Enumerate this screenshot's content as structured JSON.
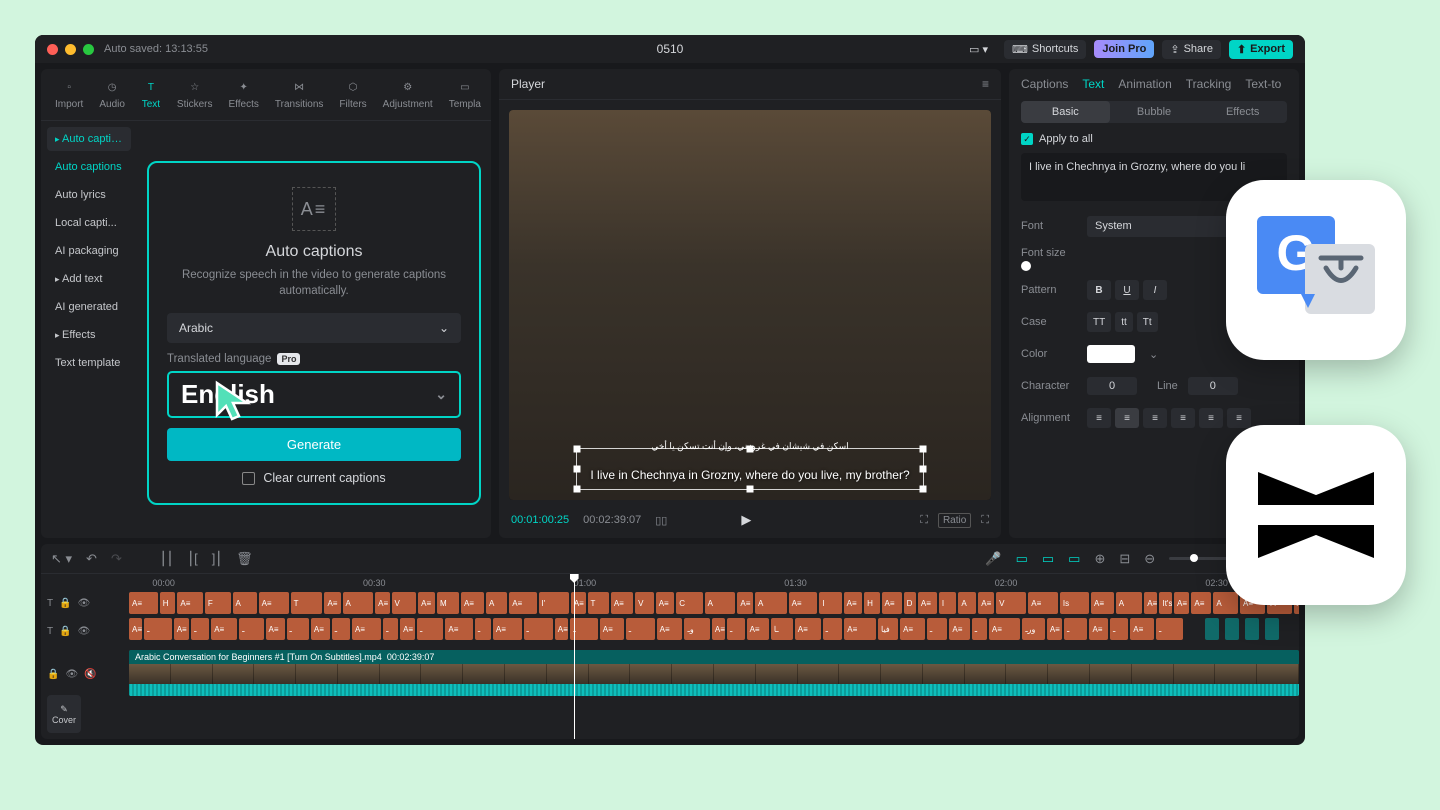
{
  "titlebar": {
    "autosave": "Auto saved: 13:13:55",
    "title": "0510",
    "shortcuts": "Shortcuts",
    "joinpro": "Join Pro",
    "share": "Share",
    "export": "Export"
  },
  "toolbar": {
    "items": [
      "Import",
      "Audio",
      "Text",
      "Stickers",
      "Effects",
      "Transitions",
      "Filters",
      "Adjustment",
      "Templa"
    ]
  },
  "sidebar": {
    "items": [
      {
        "label": "Auto captions",
        "chev": true,
        "active": true
      },
      {
        "label": "Auto captions",
        "sel": true
      },
      {
        "label": "Auto lyrics"
      },
      {
        "label": "Local capti..."
      },
      {
        "label": "AI packaging"
      },
      {
        "label": "Add text",
        "chev": true
      },
      {
        "label": "AI generated"
      },
      {
        "label": "Effects",
        "chev": true
      },
      {
        "label": "Text template"
      }
    ]
  },
  "captions": {
    "title": "Auto captions",
    "desc": "Recognize speech in the video to generate captions automatically.",
    "source_lang": "Arabic",
    "translated_label": "Translated language",
    "pro": "Pro",
    "target_lang": "English",
    "generate": "Generate",
    "clear": "Clear current captions"
  },
  "player": {
    "header": "Player",
    "sub_ar": "اسكن في شيشان في غروزني، وإن أنت تسكن يا أخي",
    "sub_en": "I live in Chechnya in Grozny, where do you live, my brother?",
    "tc_current": "00:01:00:25",
    "tc_total": "00:02:39:07",
    "ratio": "Ratio"
  },
  "right": {
    "tabs": [
      "Captions",
      "Text",
      "Animation",
      "Tracking",
      "Text-to"
    ],
    "subtabs": [
      "Basic",
      "Bubble",
      "Effects"
    ],
    "apply": "Apply to all",
    "text": "I live in Chechnya in Grozny, where do you li",
    "font_lbl": "Font",
    "font_val": "System",
    "size_lbl": "Font size",
    "pattern_lbl": "Pattern",
    "case_lbl": "Case",
    "case_vals": [
      "TT",
      "tt",
      "Tt"
    ],
    "color_lbl": "Color",
    "char_lbl": "Character",
    "char_val": "0",
    "line_lbl": "Line",
    "line_val": "0",
    "align_lbl": "Alignment"
  },
  "timeline": {
    "ticks": [
      "00:00",
      "00:30",
      "01:00",
      "01:30",
      "02:00",
      "02:30"
    ],
    "clip_title": "Arabic Conversation for Beginners #1 [Turn On Subtitles].mp4",
    "clip_dur": "00:02:39:07",
    "cover": "Cover"
  }
}
